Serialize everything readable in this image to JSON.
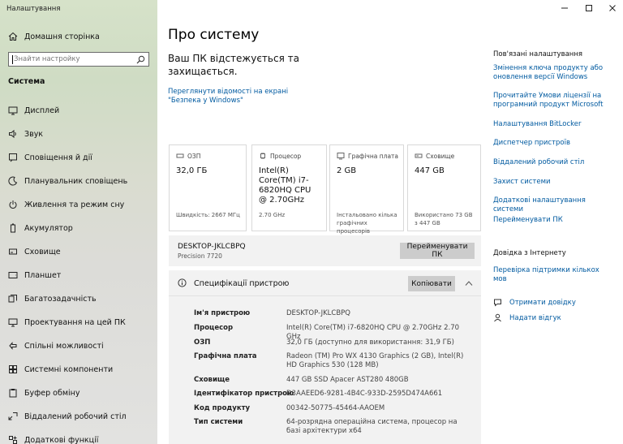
{
  "window": {
    "title": "Налаштування"
  },
  "sidebar": {
    "home_label": "Домашня сторінка",
    "search_placeholder": "Знайти настройку",
    "section_label": "Система",
    "items": [
      {
        "label": "Дисплей",
        "icon": "monitor-icon"
      },
      {
        "label": "Звук",
        "icon": "speaker-icon"
      },
      {
        "label": "Сповіщення й дії",
        "icon": "notification-icon"
      },
      {
        "label": "Планувальник сповіщень",
        "icon": "moon-icon"
      },
      {
        "label": "Живлення та режим сну",
        "icon": "power-icon"
      },
      {
        "label": "Акумулятор",
        "icon": "battery-icon"
      },
      {
        "label": "Сховище",
        "icon": "storage-icon"
      },
      {
        "label": "Планшет",
        "icon": "tablet-icon"
      },
      {
        "label": "Багатозадачність",
        "icon": "multitasking-icon"
      },
      {
        "label": "Проектування на цей ПК",
        "icon": "projecting-icon"
      },
      {
        "label": "Спільні можливості",
        "icon": "shared-experiences-icon"
      },
      {
        "label": "Системні компоненти",
        "icon": "system-components-icon"
      },
      {
        "label": "Буфер обміну",
        "icon": "clipboard-icon"
      },
      {
        "label": "Віддалений робочий стіл",
        "icon": "remote-desktop-icon"
      },
      {
        "label": "Додаткові функції",
        "icon": "optional-features-icon"
      }
    ]
  },
  "main": {
    "title": "Про систему",
    "protection_text": "Ваш ПК відстежується та захищається.",
    "protection_link": "Переглянути відомості на екрані \"Безпека у Windows\"",
    "cards": [
      {
        "label": "ОЗП",
        "value": "32,0 ГБ",
        "sub": "Швидкість: 2667 МГц",
        "icon": "ram-icon"
      },
      {
        "label": "Процесор",
        "value": "Intel(R) Core(TM) i7-6820HQ CPU @ 2.70GHz",
        "sub": "2.70 GHz",
        "icon": "cpu-icon"
      },
      {
        "label": "Графічна плата",
        "value": "2 GB",
        "sub": "Інстальовано кілька графічних процесорів",
        "icon": "gpu-icon"
      },
      {
        "label": "Сховище",
        "value": "447 GB",
        "sub": "Використано 73 GB з 447 GB",
        "icon": "disk-icon"
      }
    ],
    "device_name": "DESKTOP-JKLCBPQ",
    "device_model": "Precision 7720",
    "rename_button": "Перейменувати ПК",
    "specs_title": "Специфікації пристрою",
    "copy_button": "Копіювати",
    "specs": [
      {
        "key": "Ім'я пристрою",
        "value": "DESKTOP-JKLCBPQ"
      },
      {
        "key": "Процесор",
        "value": "Intel(R) Core(TM) i7-6820HQ CPU @ 2.70GHz   2.70 GHz"
      },
      {
        "key": "ОЗП",
        "value": "32,0 ГБ (доступно для використання: 31,9 ГБ)"
      },
      {
        "key": "Графічна плата",
        "value": "Radeon (TM) Pro WX 4130 Graphics (2 GB), Intel(R) HD Graphics 530 (128 MB)"
      },
      {
        "key": "Сховище",
        "value": "447 GB SSD Apacer AST280 480GB"
      },
      {
        "key": "Ідентифікатор пристрою",
        "value": "D3AAEED6-9281-4B4C-933D-2595D474A661"
      },
      {
        "key": "Код продукту",
        "value": "00342-50775-45464-AAOEM"
      },
      {
        "key": "Тип системи",
        "value": "64-розрядна операційна система, процесор на базі архітектури x64"
      }
    ]
  },
  "related": {
    "heading": "Пов'язані налаштування",
    "links": [
      "Змінення ключа продукту або оновлення версії Windows",
      "Прочитайте Умови ліцензії на програмний продукт Microsoft",
      "Налаштування BitLocker",
      "Диспетчер пристроїв",
      "Віддалений робочий стіл",
      "Захист системи",
      "Додаткові налаштування системи",
      "Перейменувати ПК"
    ],
    "help_heading": "Довідка з Інтернету",
    "help_link": "Перевірка підтримки кількох мов",
    "get_help": "Отримати довідку",
    "feedback": "Надати відгук"
  }
}
